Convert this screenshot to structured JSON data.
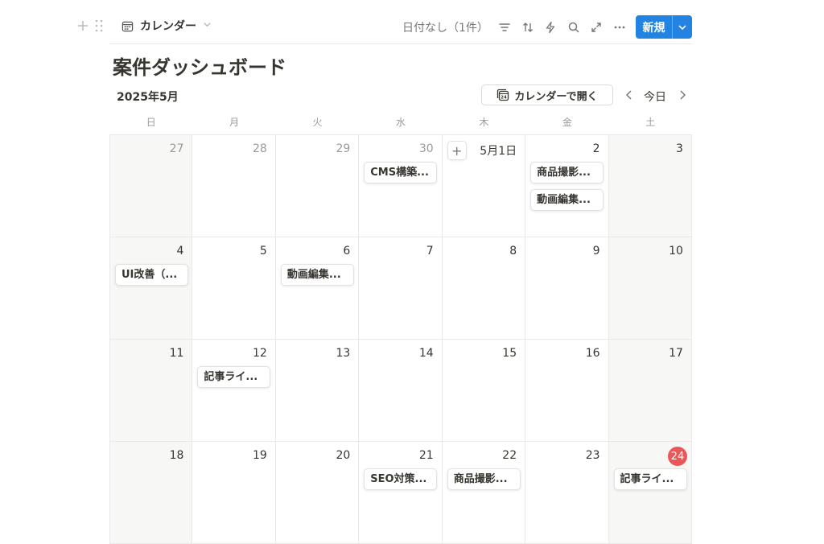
{
  "toolbar": {
    "view_label": "カレンダー",
    "no_date_label": "日付なし（1件）",
    "new_label": "新規"
  },
  "page": {
    "title": "案件ダッシュボード",
    "month_label": "2025年5月",
    "open_calendar_label": "カレンダーで開く",
    "today_label": "今日"
  },
  "weekdays": [
    "日",
    "月",
    "火",
    "水",
    "木",
    "金",
    "土"
  ],
  "weeks": [
    [
      {
        "label": "27",
        "other": true,
        "events": []
      },
      {
        "label": "28",
        "other": true,
        "events": []
      },
      {
        "label": "29",
        "other": true,
        "events": []
      },
      {
        "label": "30",
        "other": true,
        "events": [
          "CMS構築..."
        ]
      },
      {
        "label": "5月1日",
        "other": false,
        "add_button": true,
        "events": []
      },
      {
        "label": "2",
        "other": false,
        "events": [
          "商品撮影...",
          "動画編集..."
        ]
      },
      {
        "label": "3",
        "other": false,
        "events": []
      }
    ],
    [
      {
        "label": "4",
        "events": [
          "UI改善（..."
        ]
      },
      {
        "label": "5",
        "events": []
      },
      {
        "label": "6",
        "events": [
          "動画編集..."
        ]
      },
      {
        "label": "7",
        "events": []
      },
      {
        "label": "8",
        "events": []
      },
      {
        "label": "9",
        "events": []
      },
      {
        "label": "10",
        "events": []
      }
    ],
    [
      {
        "label": "11",
        "events": []
      },
      {
        "label": "12",
        "events": [
          "記事ライ..."
        ]
      },
      {
        "label": "13",
        "events": []
      },
      {
        "label": "14",
        "events": []
      },
      {
        "label": "15",
        "events": []
      },
      {
        "label": "16",
        "events": []
      },
      {
        "label": "17",
        "events": []
      }
    ],
    [
      {
        "label": "18",
        "events": []
      },
      {
        "label": "19",
        "events": []
      },
      {
        "label": "20",
        "events": []
      },
      {
        "label": "21",
        "events": [
          "SEO対策..."
        ]
      },
      {
        "label": "22",
        "events": [
          "商品撮影..."
        ]
      },
      {
        "label": "23",
        "events": []
      },
      {
        "label": "24",
        "today": true,
        "events": [
          "記事ライ..."
        ]
      }
    ]
  ],
  "colors": {
    "accent": "#2383e2",
    "today": "#eb5757",
    "weekend_bg": "#f7f7f5",
    "text": "#37352f",
    "muted": "#9b9a97"
  },
  "icons": [
    "plus-icon",
    "drag-handle-icon",
    "calendar-icon",
    "filter-icon",
    "sort-icon",
    "lightning-icon",
    "search-icon",
    "expand-icon",
    "more-icon",
    "chevron-down-icon",
    "chevron-left-icon",
    "chevron-right-icon"
  ]
}
